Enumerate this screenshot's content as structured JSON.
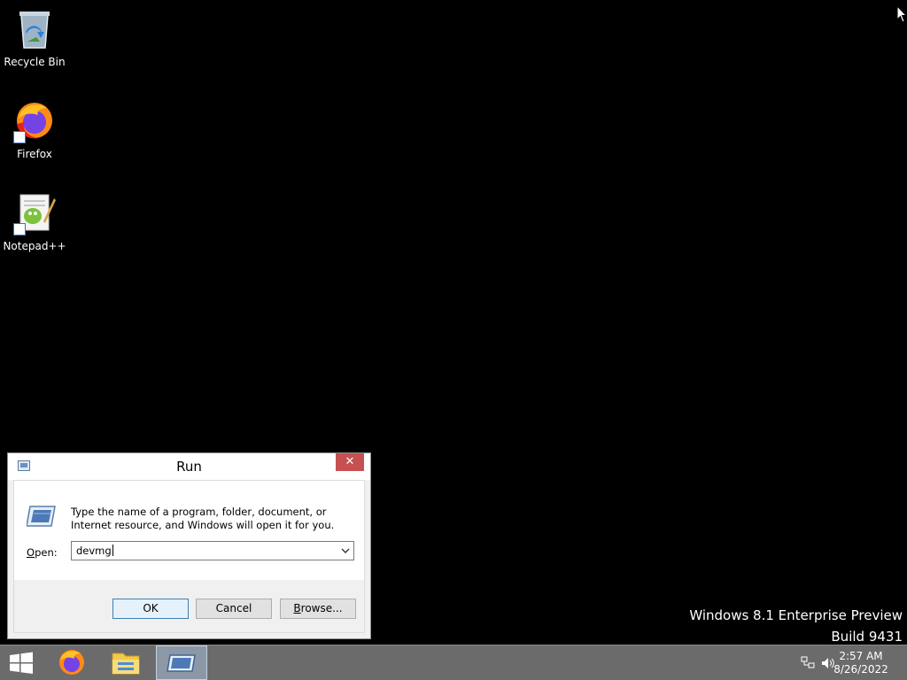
{
  "desktop": {
    "icons": [
      {
        "label": "Recycle Bin"
      },
      {
        "label": "Firefox"
      },
      {
        "label": "Notepad++"
      }
    ],
    "watermark": {
      "line1": "Windows 8.1 Enterprise Preview",
      "line2": "Build 9431"
    }
  },
  "run_dialog": {
    "title": "Run",
    "close_glyph": "✕",
    "description": "Type the name of a program, folder, document, or Internet resource, and Windows will open it for you.",
    "open_label_prefix": "O",
    "open_label_rest": "pen:",
    "input_value": "devmg",
    "buttons": {
      "ok": "OK",
      "cancel": "Cancel",
      "browse_prefix": "B",
      "browse_rest": "rowse..."
    }
  },
  "taskbar": {
    "clock_time": "2:57 AM",
    "clock_date": "8/26/2022",
    "items": [
      {
        "icon": "windows-start-icon"
      },
      {
        "icon": "firefox-icon"
      },
      {
        "icon": "file-explorer-icon"
      },
      {
        "icon": "run-icon",
        "active": true
      }
    ]
  },
  "colors": {
    "desktop_bg": "#000000",
    "taskbar_bg": "#6b6b6b",
    "close_red": "#c75050",
    "default_button_border": "#3c7fb1"
  }
}
